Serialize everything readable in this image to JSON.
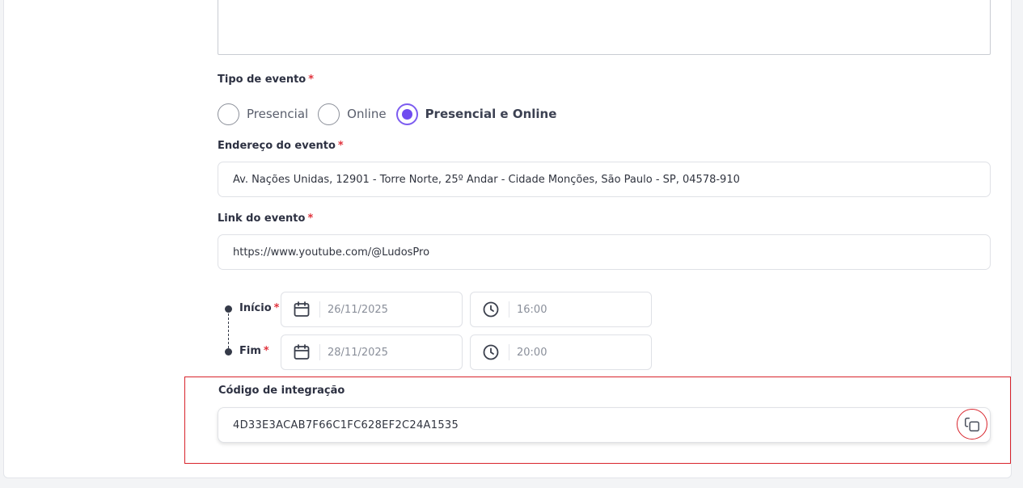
{
  "form": {
    "event_type": {
      "label": "Tipo de evento",
      "required_mark": "*",
      "options": [
        {
          "label": "Presencial",
          "checked": false
        },
        {
          "label": "Online",
          "checked": false
        },
        {
          "label": "Presencial e Online",
          "checked": true
        }
      ]
    },
    "address": {
      "label": "Endereço do evento",
      "required_mark": "*",
      "value": "Av. Nações Unidas, 12901 - Torre Norte, 25º Andar - Cidade Monções, São Paulo - SP, 04578-910"
    },
    "link": {
      "label": "Link do evento",
      "required_mark": "*",
      "value": "https://www.youtube.com/@LudosPro"
    },
    "schedule": {
      "start": {
        "label": "Início",
        "required_mark": "*",
        "date": "26/11/2025",
        "time": "16:00"
      },
      "end": {
        "label": "Fim",
        "required_mark": "*",
        "date": "28/11/2025",
        "time": "20:00"
      }
    },
    "integration": {
      "label": "Código de integração",
      "value": "4D33E3ACAB7F66C1FC628EF2C24A1535",
      "copy_icon": "copy-icon"
    }
  },
  "colors": {
    "accent": "#6f4cf0",
    "required": "#e0323c",
    "highlight": "#d8242c"
  }
}
